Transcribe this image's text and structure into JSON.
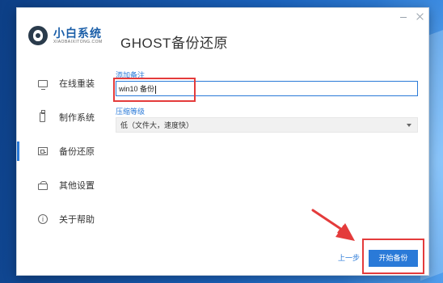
{
  "app": {
    "brand_cn": "小白系统",
    "brand_en": "XIAOBAIXITONG.COM",
    "title": "GHOST备份还原"
  },
  "window_controls": {
    "minimize_icon": "minimize-icon",
    "close_icon": "close-icon"
  },
  "sidebar": {
    "items": [
      {
        "label": "在线重装",
        "icon": "monitor-icon",
        "active": false
      },
      {
        "label": "制作系统",
        "icon": "usb-drive-icon",
        "active": false
      },
      {
        "label": "备份还原",
        "icon": "backup-icon",
        "active": true
      },
      {
        "label": "其他设置",
        "icon": "toolbox-icon",
        "active": false
      },
      {
        "label": "关于帮助",
        "icon": "info-icon",
        "active": false
      }
    ]
  },
  "form": {
    "note_label": "添加备注",
    "note_value": "win10 备份",
    "compression_label": "压缩等级",
    "compression_value": "低（文件大，速度快）"
  },
  "footer": {
    "prev_label": "上一步",
    "start_label": "开始备份"
  },
  "colors": {
    "accent": "#2a7ad8",
    "annotation_red": "#e43b3b",
    "brand_blue": "#1a5ea8"
  }
}
